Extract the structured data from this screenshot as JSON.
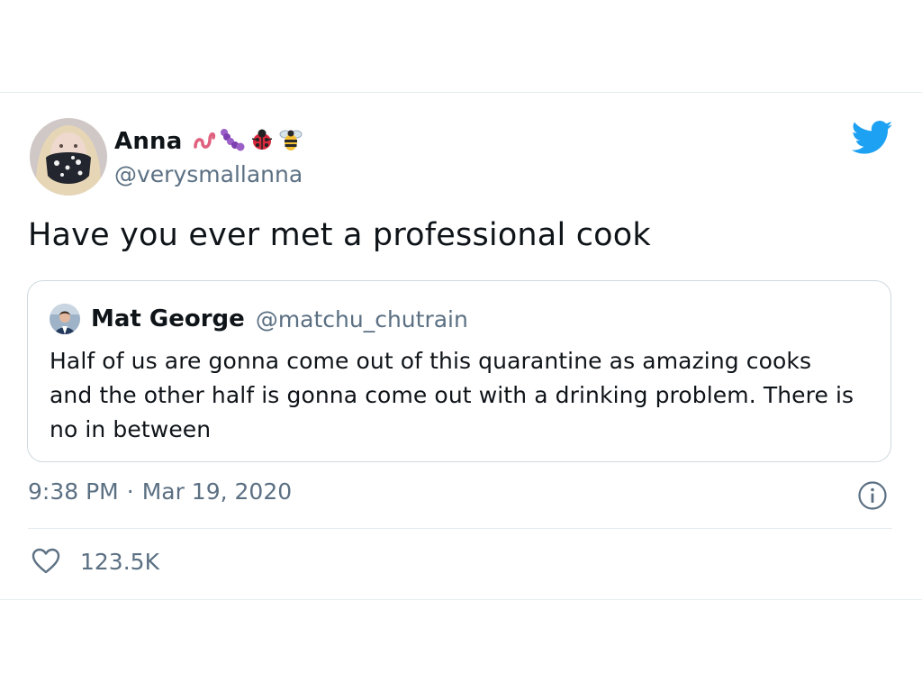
{
  "author": {
    "display_name": "Anna",
    "handle": "@verysmallanna",
    "name_emojis": [
      "worm-icon",
      "caterpillar-icon",
      "ladybug-icon",
      "bee-icon"
    ]
  },
  "tweet": {
    "text": "Have you ever met a professional cook",
    "time": "9:38 PM",
    "separator": "·",
    "date": "Mar 19, 2020",
    "likes": "123.5K"
  },
  "quoted_tweet": {
    "display_name": "Mat George",
    "handle": "@matchu_chutrain",
    "text": "Half of us are gonna come out of this quarantine as amazing cooks and the other half is gonna come out with a drinking problem. There is no in between"
  },
  "colors": {
    "twitter_blue": "#1da1f2",
    "secondary_text": "#5b7083",
    "border": "#cfd9de"
  }
}
